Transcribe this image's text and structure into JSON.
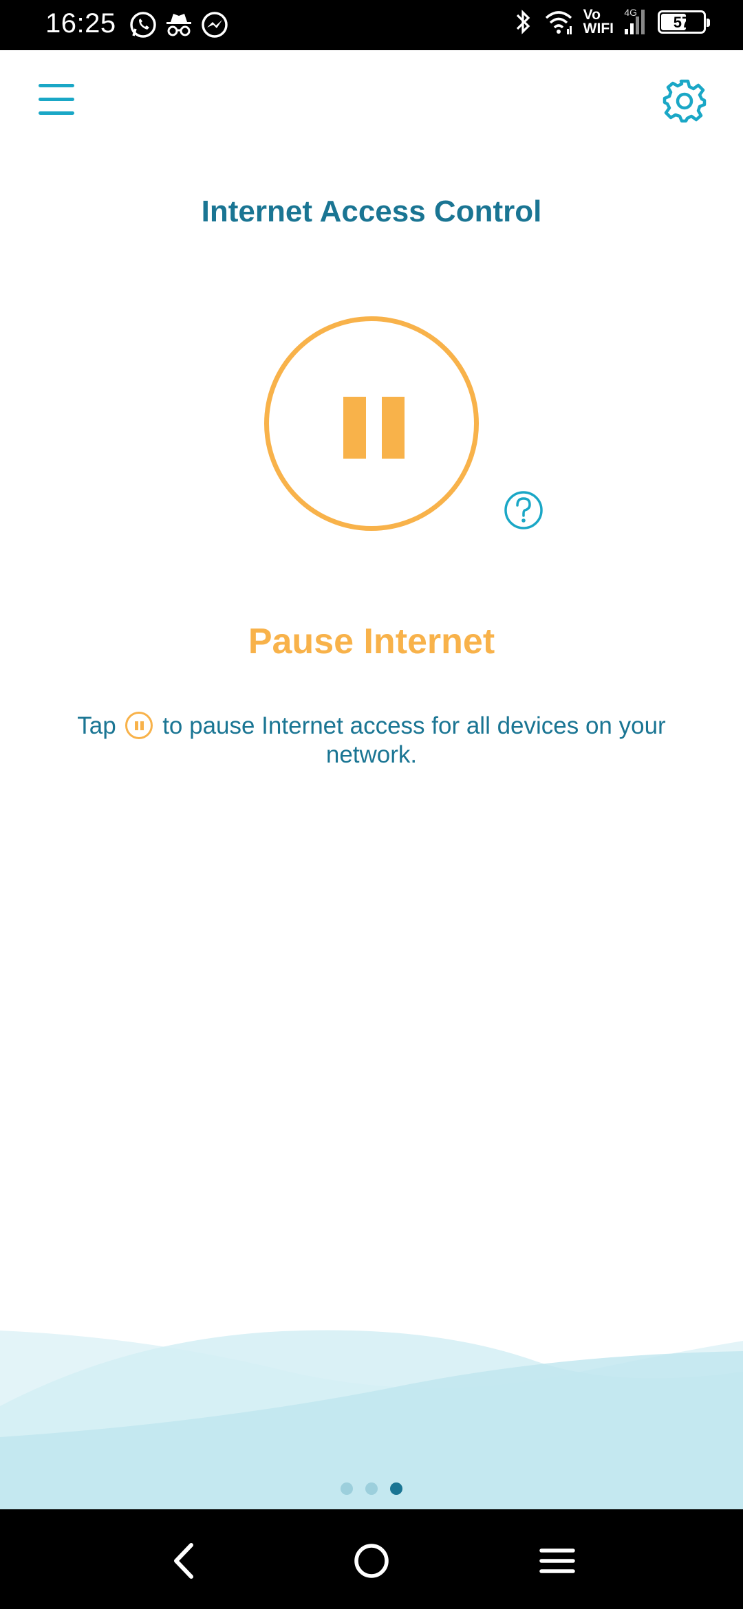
{
  "status_bar": {
    "time": "16:25",
    "left_icons": [
      "whatsapp-icon",
      "incognito-icon",
      "messenger-icon"
    ],
    "right_icons": [
      "bluetooth-icon",
      "wifi-icon",
      "signal-icon"
    ],
    "vo_label": "Vo",
    "wifi_label": "WIFI",
    "network_tag": "4G",
    "battery": "57"
  },
  "header": {
    "title": "Internet Access Control"
  },
  "main": {
    "pause_label": "Pause Internet",
    "description_before": "Tap",
    "description_after": "to pause Internet access for all devices on your network.",
    "page_indicator": {
      "count": 3,
      "active": 3
    }
  },
  "colors": {
    "accent_orange": "#f8b24a",
    "title_teal": "#1a7593",
    "icon_cyan": "#1aa7c6",
    "wave_light": "#c9e9f1"
  },
  "nav_bar": {
    "buttons": [
      "back-icon",
      "home-icon",
      "recents-icon"
    ]
  }
}
